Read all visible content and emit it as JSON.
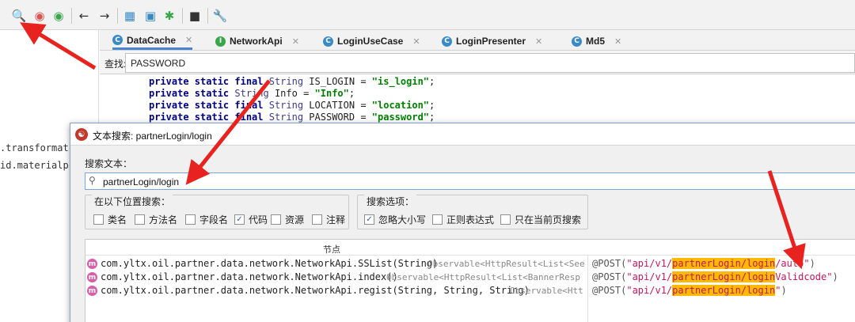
{
  "toolbar": {
    "icons": [
      "search-icon",
      "search-replace-icon",
      "search-refresh-icon",
      "back-arrow-icon",
      "forward-arrow-icon",
      "structure-icon",
      "bookmark-icon",
      "debug-icon",
      "stop-icon",
      "wrench-icon"
    ]
  },
  "left_panel": {
    "lines": [
      ".transformat",
      "id.materialpr"
    ]
  },
  "tabs": [
    {
      "label": "DataCache",
      "type": "C",
      "color": "#3a8ac4",
      "active": true
    },
    {
      "label": "NetworkApi",
      "type": "I",
      "color": "#3aa64a",
      "active": false
    },
    {
      "label": "LoginUseCase",
      "type": "C",
      "color": "#3a8ac4",
      "active": false
    },
    {
      "label": "LoginPresenter",
      "type": "C",
      "color": "#3a8ac4",
      "active": false
    },
    {
      "label": "Md5",
      "type": "C",
      "color": "#3a8ac4",
      "active": false
    }
  ],
  "find_bar": {
    "label": "查找:",
    "value": "PASSWORD"
  },
  "code": {
    "lines": [
      {
        "kw": "private static final ",
        "type": "String",
        "rest": " IS_LOGIN = ",
        "str": "\"is_login\"",
        "end": ";"
      },
      {
        "kw": "private static ",
        "type": "String",
        "rest": " Info = ",
        "str": "\"Info\"",
        "end": ";"
      },
      {
        "kw": "private static final ",
        "type": "String",
        "rest": " LOCATION = ",
        "str": "\"location\"",
        "end": ";"
      },
      {
        "kw": "private static final ",
        "type": "String",
        "rest": " PASSWORD = ",
        "str": "\"password\"",
        "end": ";"
      }
    ]
  },
  "dialog": {
    "title": "文本搜索: partnerLogin/login",
    "search_label": "搜索文本：",
    "search_value": "partnerLogin/login",
    "location_group": {
      "title": "在以下位置搜索：",
      "options": [
        {
          "label": "类名",
          "checked": false
        },
        {
          "label": "方法名",
          "checked": false
        },
        {
          "label": "字段名",
          "checked": false
        },
        {
          "label": "代码",
          "checked": true
        },
        {
          "label": "资源",
          "checked": false
        },
        {
          "label": "注释",
          "checked": false
        }
      ]
    },
    "options_group": {
      "title": "搜索选项：",
      "options": [
        {
          "label": "忽略大小写",
          "checked": true
        },
        {
          "label": "正则表达式",
          "checked": false
        },
        {
          "label": "只在当前页搜索",
          "checked": false
        }
      ]
    },
    "results": {
      "header": "节点",
      "rows": [
        {
          "signature": "com.yltx.oil.partner.data.network.NetworkApi.SSList(String)",
          "return_type": "Observable<HttpResult<List<See",
          "code_prefix": "@POST(",
          "code_str_pre": "\"api/v1/",
          "code_match": "partnerLogin/login",
          "code_str_post": "/auto\"",
          "code_end": ")"
        },
        {
          "signature": "com.yltx.oil.partner.data.network.NetworkApi.index()",
          "return_type": "Observable<HttpResult<List<BannerResp",
          "code_prefix": "@POST(",
          "code_str_pre": "\"api/v1/",
          "code_match": "partnerLogin/login",
          "code_str_post": "Validcode\"",
          "code_end": ")"
        },
        {
          "signature": "com.yltx.oil.partner.data.network.NetworkApi.regist(String, String, String)",
          "return_type": "Observable<Htt",
          "code_prefix": "@POST(",
          "code_str_pre": "\"api/v1/",
          "code_match": "partnerLogin/login",
          "code_str_post": "\"",
          "code_end": ")"
        }
      ]
    }
  },
  "colors": {
    "arrow": "#e8231f",
    "highlight": "#ffb900",
    "accent": "#4a86d0"
  }
}
